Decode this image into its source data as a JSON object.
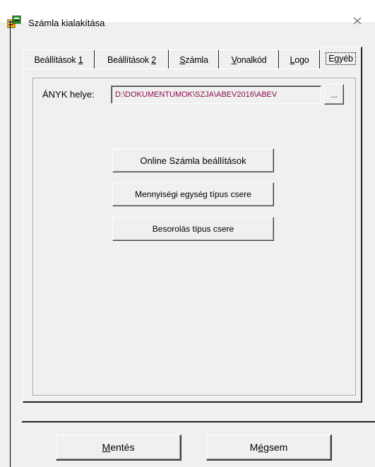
{
  "window": {
    "title": "Számla kialakítása",
    "icon": "app-icon",
    "close_glyph": "☒"
  },
  "tabs": [
    {
      "label_before": "Beállítások ",
      "mnemonic": "1",
      "label_after": ""
    },
    {
      "label_before": "Beállítások ",
      "mnemonic": "2",
      "label_after": ""
    },
    {
      "label_before": "",
      "mnemonic": "S",
      "label_after": "zámla"
    },
    {
      "label_before": "",
      "mnemonic": "V",
      "label_after": "onalkód"
    },
    {
      "label_before": "",
      "mnemonic": "L",
      "label_after": "ogo"
    },
    {
      "label_before": "Egyéb",
      "mnemonic": "",
      "label_after": "",
      "active": true
    }
  ],
  "anyk": {
    "label": "ÁNYK helye:",
    "path_value": "D:\\DOKUMENTUMOK\\SZJA\\ABEV2016\\ABEV",
    "browse_label": "..."
  },
  "buttons": {
    "online": "Online Számla beállítások",
    "mennyisegi": "Mennyiségi egység típus csere",
    "besorolas": "Besorolás típus csere"
  },
  "footer": {
    "save_before": "",
    "save_mnemonic": "M",
    "save_after": "entés",
    "cancel_before": "M",
    "cancel_mnemonic": "é",
    "cancel_after": "gsem"
  },
  "colors": {
    "path_text": "#8b0d4a",
    "face": "#f0f0f0"
  }
}
